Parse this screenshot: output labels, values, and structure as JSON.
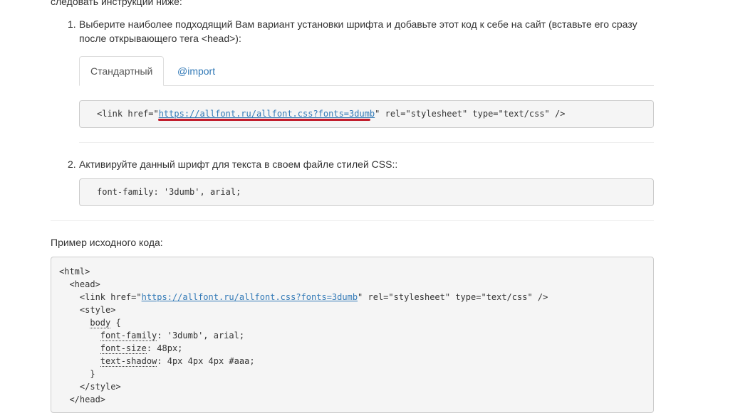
{
  "intro_text": "следовать инструкции ниже:",
  "steps": [
    {
      "number": "1.",
      "line1": "Выберите наиболее подходящий Вам вариант установки шрифта и добавьте этот код к себе на сайт (вставьте его сразу",
      "line2": "после открывающего тега <head>):"
    },
    {
      "number": "2.",
      "line1": "Активируйте данный шрифт для текста в своем файле стилей CSS::"
    }
  ],
  "tabs": [
    {
      "label": "Стандартный",
      "active": true
    },
    {
      "label": "@import",
      "active": false
    }
  ],
  "link_code": {
    "prefix": "<link href=\"",
    "url": "https://allfont.ru/allfont.css?fonts=3dumb",
    "suffix": "\" rel=\"stylesheet\" type=\"text/css\" />"
  },
  "css_code": "font-family: '3dumb', arial;",
  "example_label": "Пример исходного кода:",
  "example": {
    "html_open": "<html>",
    "head_open": "<head>",
    "link_prefix": "<link href=\"",
    "link_url": "https://allfont.ru/allfont.css?fonts=3dumb",
    "link_suffix": "\" rel=\"stylesheet\" type=\"text/css\" />",
    "style_open": "<style>",
    "selector": "body",
    "brace_open": " {",
    "props": [
      {
        "name": "font-family",
        "value": ": '3dumb', arial;"
      },
      {
        "name": "font-size",
        "value": ": 48px;"
      },
      {
        "name": "text-shadow",
        "value": ": 4px 4px 4px #aaa;"
      }
    ],
    "brace_close": "}",
    "style_close": "</style>",
    "head_close": "</head>"
  },
  "colors": {
    "link": "#337ab7",
    "highlight": "#c01a2a",
    "code_bg": "#f5f5f5"
  }
}
